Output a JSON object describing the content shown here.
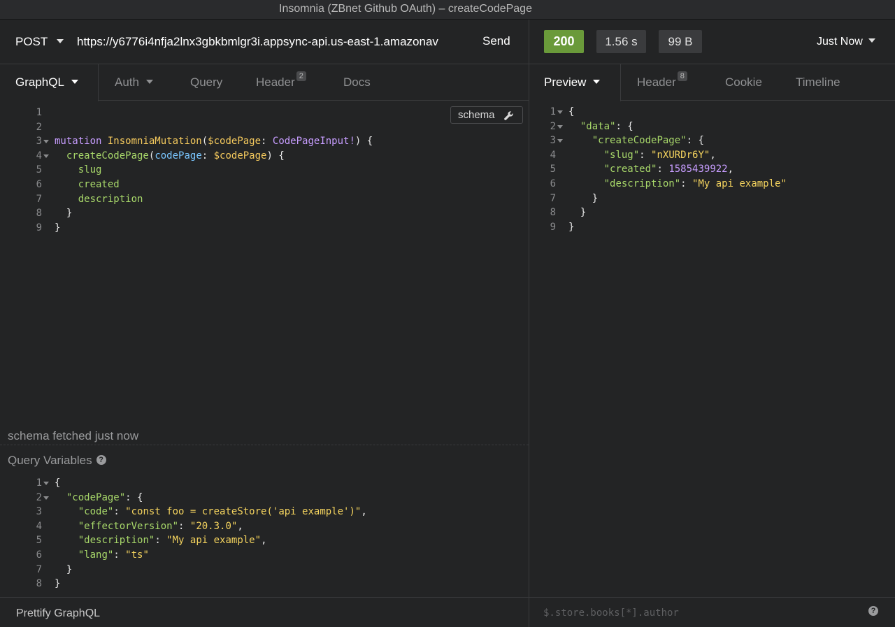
{
  "window": {
    "title": "Insomnia (ZBnet Github OAuth) – createCodePage"
  },
  "request": {
    "method": "POST",
    "url": "https://y6776i4nfja2lnx3gbkbmlgr3i.appsync-api.us-east-1.amazonav",
    "send_label": "Send",
    "tabs": [
      {
        "label": "GraphQL",
        "active": true,
        "dropdown": true
      },
      {
        "label": "Auth",
        "dropdown": true
      },
      {
        "label": "Query"
      },
      {
        "label": "Header",
        "badge": "2"
      },
      {
        "label": "Docs"
      }
    ],
    "schema_button": "schema",
    "editor_lines": [
      {
        "n": "1",
        "fold": false
      },
      {
        "n": "2",
        "fold": false
      },
      {
        "n": "3",
        "fold": true
      },
      {
        "n": "4",
        "fold": true
      },
      {
        "n": "5",
        "fold": false
      },
      {
        "n": "6",
        "fold": false
      },
      {
        "n": "7",
        "fold": false
      },
      {
        "n": "8",
        "fold": false
      },
      {
        "n": "9",
        "fold": false
      }
    ],
    "query": {
      "keyword": "mutation",
      "operation_name": "InsomniaMutation",
      "variable": "$codePage",
      "variable_type": "CodePageInput!",
      "field": "createCodePage",
      "argument": "codePage",
      "argument_value": "$codePage",
      "selections": [
        "slug",
        "created",
        "description"
      ]
    },
    "schema_status": "schema fetched just now",
    "variables_title": "Query Variables",
    "variables_lines": [
      {
        "n": "1",
        "fold": true
      },
      {
        "n": "2",
        "fold": true
      },
      {
        "n": "3",
        "fold": false
      },
      {
        "n": "4",
        "fold": false
      },
      {
        "n": "5",
        "fold": false
      },
      {
        "n": "6",
        "fold": false
      },
      {
        "n": "7",
        "fold": false
      },
      {
        "n": "8",
        "fold": false
      }
    ],
    "variables": {
      "root_key": "codePage",
      "entries": [
        {
          "key": "code",
          "value": "const foo = createStore('api example')"
        },
        {
          "key": "effectorVersion",
          "value": "20.3.0"
        },
        {
          "key": "description",
          "value": "My api example"
        },
        {
          "key": "lang",
          "value": "ts"
        }
      ]
    },
    "footer_label": "Prettify GraphQL"
  },
  "response": {
    "status_code": "200",
    "duration": "1.56 s",
    "size": "99 B",
    "time_ago": "Just Now",
    "tabs": [
      {
        "label": "Preview",
        "active": true,
        "dropdown": true
      },
      {
        "label": "Header",
        "badge": "8"
      },
      {
        "label": "Cookie"
      },
      {
        "label": "Timeline"
      }
    ],
    "lines": [
      {
        "n": "1",
        "fold": true
      },
      {
        "n": "2",
        "fold": true
      },
      {
        "n": "3",
        "fold": true
      },
      {
        "n": "4",
        "fold": false
      },
      {
        "n": "5",
        "fold": false
      },
      {
        "n": "6",
        "fold": false
      },
      {
        "n": "7",
        "fold": false
      },
      {
        "n": "8",
        "fold": false
      },
      {
        "n": "9",
        "fold": false
      }
    ],
    "body": {
      "data_key": "data",
      "mutation_key": "createCodePage",
      "slug_key": "slug",
      "slug": "nXURDr6Y",
      "created_key": "created",
      "created": "1585439922",
      "description_key": "description",
      "description": "My api example"
    },
    "filter_placeholder": "$.store.books[*].author"
  },
  "colors": {
    "status_ok": "#6a9a3a",
    "background": "#232425",
    "keyword": "#c79dff",
    "string": "#f4d35e",
    "json_key": "#a8d86a"
  }
}
